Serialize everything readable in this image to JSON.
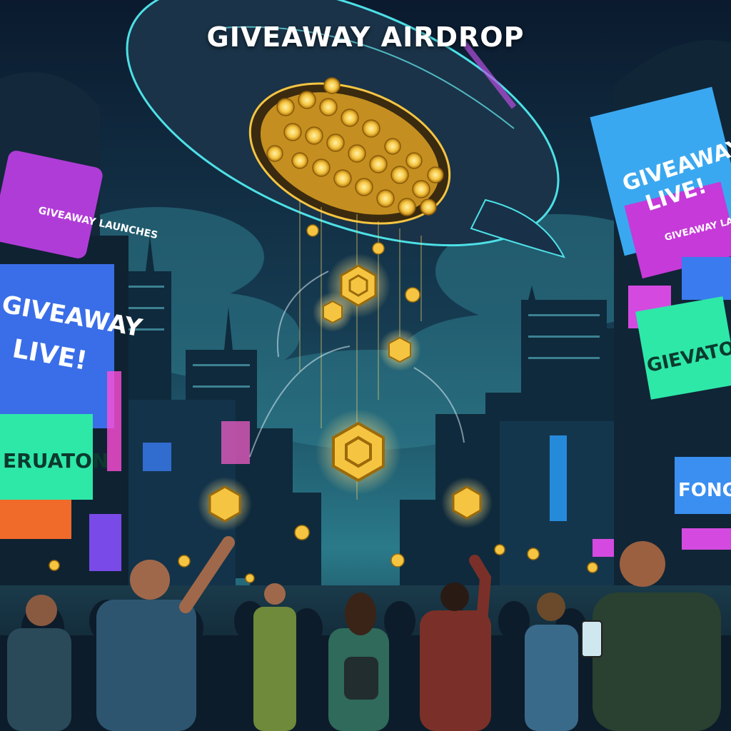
{
  "title": "GIVEAWAY AIRDROP",
  "signs": {
    "left_top": "GIVEAWAY LAUNCHES",
    "left_big_line1": "GIVEAWAY",
    "left_big_line2": "LIVE!",
    "left_green": "ERUATON",
    "right_big_line1": "GIVEAWAY",
    "right_big_line2": "LIVE!",
    "right_purple": "GIVEAWAY LAUNCHES",
    "right_green": "GIEVATOON",
    "right_blue": "FONG"
  },
  "colors": {
    "sky_top": "#0b1a2e",
    "sky_mid": "#1b4a5e",
    "glow_cyan": "#4de0e6",
    "coin_gold": "#f5c542",
    "sign_purple": "#b03cd8",
    "sign_blue": "#3a7bf0",
    "sign_green": "#2ee8a8",
    "sign_orange": "#f06a2a"
  }
}
